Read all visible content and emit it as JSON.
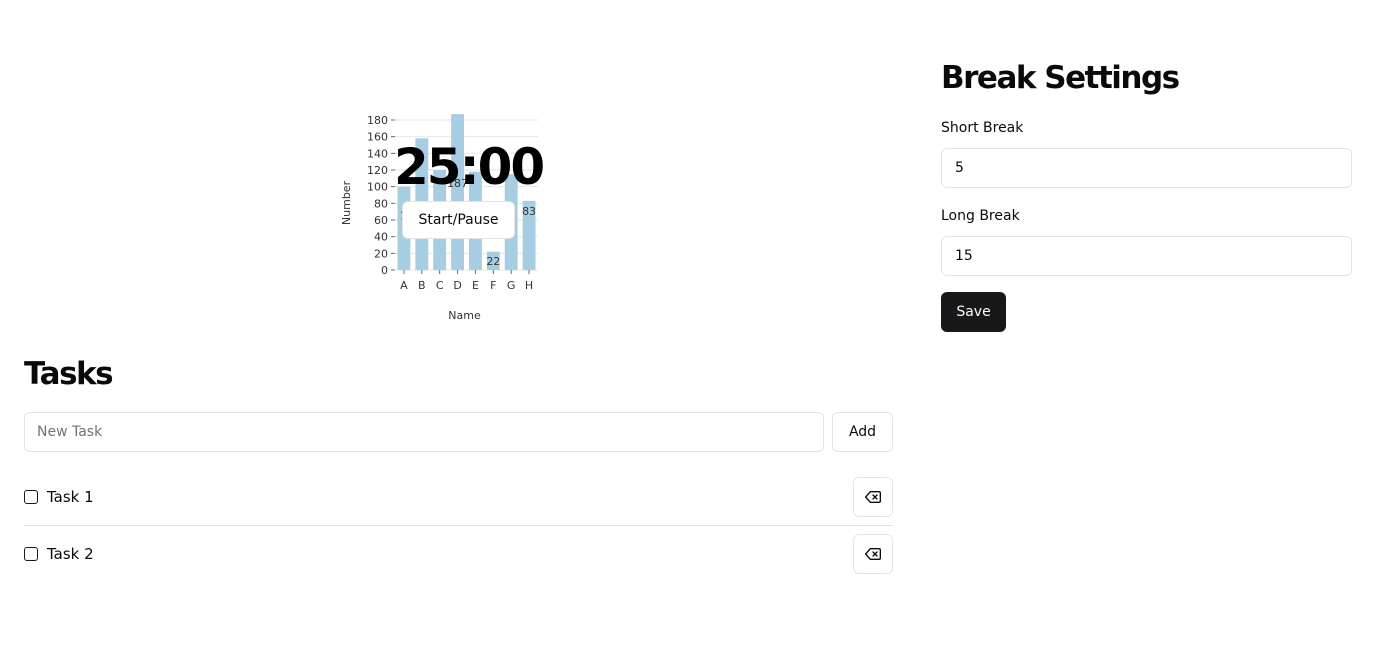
{
  "chart_data": {
    "type": "bar",
    "categories": [
      "A",
      "B",
      "C",
      "D",
      "E",
      "F",
      "G",
      "H"
    ],
    "values": [
      100,
      158,
      120,
      187,
      118,
      22,
      115,
      83
    ],
    "visible_data_labels": {
      "3": "187",
      "5": "22",
      "7": "83"
    },
    "partial_data_labels": {
      "0": "1"
    },
    "xlabel": "Name",
    "ylabel": "Number",
    "ylim": [
      0,
      180
    ],
    "yticks": [
      0,
      20,
      40,
      60,
      80,
      100,
      120,
      140,
      160,
      180
    ],
    "grid": "horizontal",
    "bar_color": "#a6cde2"
  },
  "timer": {
    "display": "25:00",
    "start_pause_label": "Start/Pause"
  },
  "tasks": {
    "heading": "Tasks",
    "input_placeholder": "New Task",
    "input_value": "",
    "add_label": "Add",
    "items": [
      {
        "label": "Task 1",
        "checked": false,
        "delete_icon": "backspace-icon"
      },
      {
        "label": "Task 2",
        "checked": false,
        "delete_icon": "backspace-icon"
      }
    ]
  },
  "break_settings": {
    "heading": "Break Settings",
    "short_break_label": "Short Break",
    "short_break_value": "5",
    "long_break_label": "Long Break",
    "long_break_value": "15",
    "save_label": "Save"
  },
  "colors": {
    "primary_button": "#18181b",
    "border": "#e4e4e7"
  }
}
